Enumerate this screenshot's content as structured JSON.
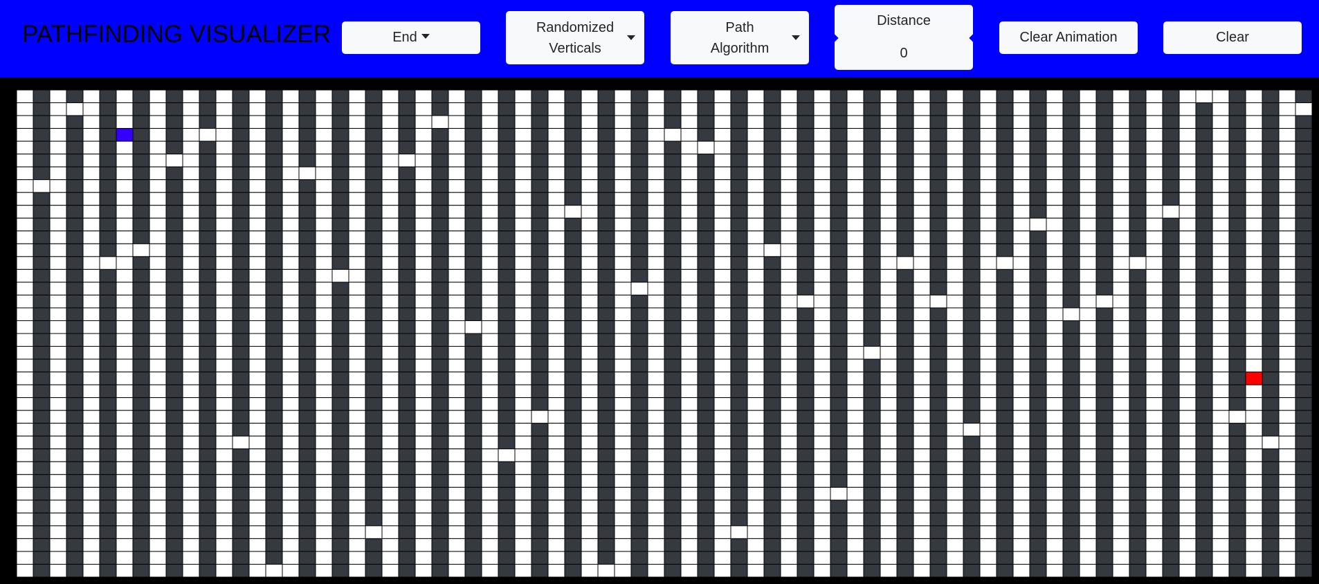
{
  "navbar": {
    "brand": "PATHFINDING VISUALIZER",
    "end_dropdown": "End",
    "maze_dropdown": [
      "Randomized",
      "Verticals"
    ],
    "algorithm_dropdown": [
      "Path",
      "Algorithm"
    ],
    "distance_label": "Distance",
    "distance_value": "0",
    "clear_animation": "Clear Animation",
    "clear": "Clear"
  },
  "grid": {
    "cols": 78,
    "rows": 38,
    "colors": {
      "empty": "#ffffff",
      "wall": "#343a40",
      "start": "#3300ff",
      "end": "#ff0000",
      "gridline": "#000000"
    },
    "wall_columns": [
      1,
      3,
      5,
      7,
      9,
      11,
      13,
      15,
      17,
      19,
      21,
      23,
      25,
      27,
      29,
      31,
      33,
      35,
      37,
      39,
      41,
      43,
      45,
      47,
      49,
      51,
      53,
      55,
      57,
      59,
      61,
      63,
      65,
      67,
      69,
      71,
      73,
      75,
      77
    ],
    "wall_gaps": [
      {
        "col": 1,
        "row": 7
      },
      {
        "col": 3,
        "row": 1
      },
      {
        "col": 5,
        "row": 13
      },
      {
        "col": 7,
        "row": 12
      },
      {
        "col": 9,
        "row": 5
      },
      {
        "col": 11,
        "row": 3
      },
      {
        "col": 13,
        "row": 27
      },
      {
        "col": 15,
        "row": 37
      },
      {
        "col": 17,
        "row": 6
      },
      {
        "col": 19,
        "row": 14
      },
      {
        "col": 21,
        "row": 34
      },
      {
        "col": 23,
        "row": 5
      },
      {
        "col": 25,
        "row": 2
      },
      {
        "col": 27,
        "row": 18
      },
      {
        "col": 29,
        "row": 28
      },
      {
        "col": 31,
        "row": 25
      },
      {
        "col": 33,
        "row": 9
      },
      {
        "col": 35,
        "row": 37
      },
      {
        "col": 37,
        "row": 15
      },
      {
        "col": 39,
        "row": 3
      },
      {
        "col": 41,
        "row": 4
      },
      {
        "col": 43,
        "row": 34
      },
      {
        "col": 45,
        "row": 12
      },
      {
        "col": 47,
        "row": 16
      },
      {
        "col": 49,
        "row": 31
      },
      {
        "col": 51,
        "row": 20
      },
      {
        "col": 53,
        "row": 13
      },
      {
        "col": 55,
        "row": 16
      },
      {
        "col": 57,
        "row": 26
      },
      {
        "col": 59,
        "row": 13
      },
      {
        "col": 61,
        "row": 10
      },
      {
        "col": 63,
        "row": 17
      },
      {
        "col": 65,
        "row": 16
      },
      {
        "col": 67,
        "row": 13
      },
      {
        "col": 69,
        "row": 9
      },
      {
        "col": 71,
        "row": 0
      },
      {
        "col": 73,
        "row": 25
      },
      {
        "col": 75,
        "row": 27
      },
      {
        "col": 77,
        "row": 1
      }
    ],
    "start_node": {
      "col": 6,
      "row": 3
    },
    "end_node": {
      "col": 74,
      "row": 22
    }
  }
}
